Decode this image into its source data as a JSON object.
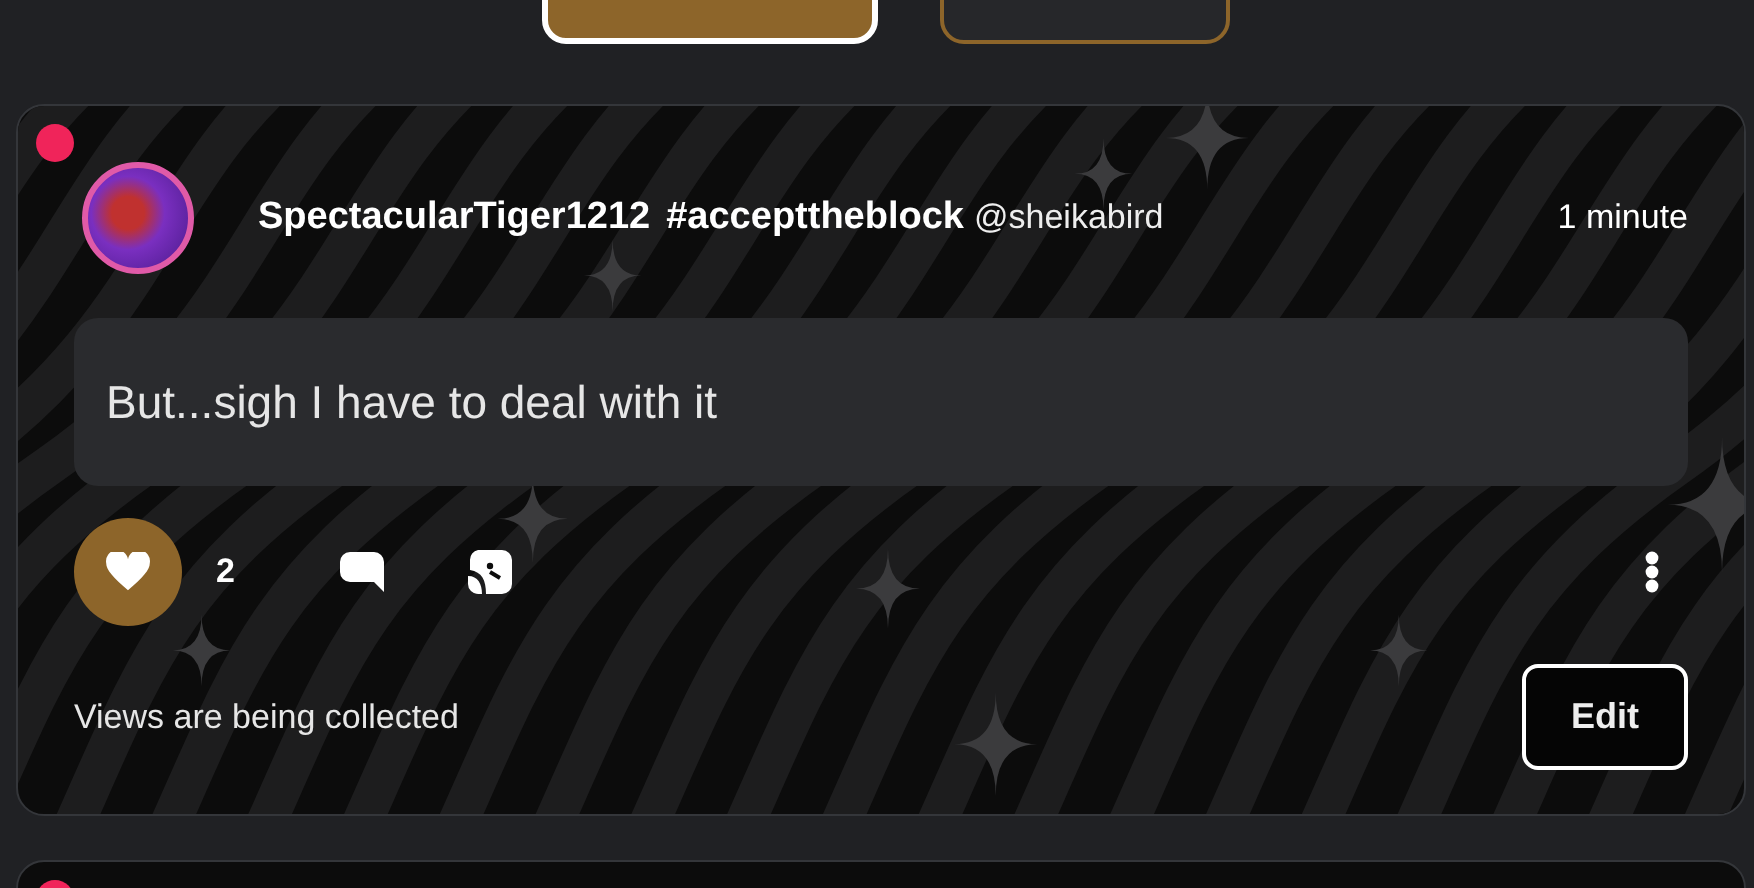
{
  "top_buttons": [
    {
      "selected": true
    },
    {
      "selected": false
    }
  ],
  "posts": [
    {
      "online": true,
      "author": "SpectacularTiger1212",
      "tag": "#accepttheblock",
      "handle": "@sheikabird",
      "time": "1 minute",
      "message": "But...sigh I have to deal with it",
      "likes": {
        "count": "2",
        "liked": true
      },
      "views": "Views are being collected",
      "edit_button": "Edit"
    }
  ],
  "next_post": {
    "online": true
  }
}
